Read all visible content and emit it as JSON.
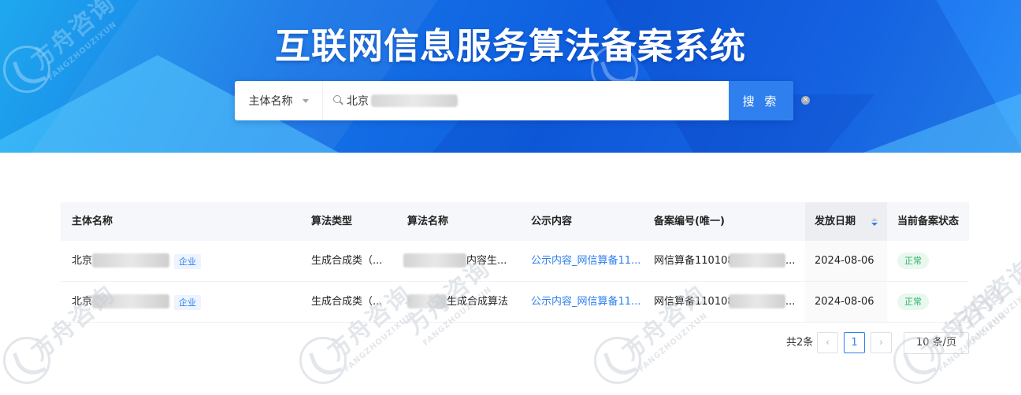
{
  "header": {
    "title": "互联网信息服务算法备案系统"
  },
  "search": {
    "scope_label": "主体名称",
    "query_value": "北京",
    "button_label": "搜 索"
  },
  "table": {
    "columns": [
      "主体名称",
      "算法类型",
      "算法名称",
      "公示内容",
      "备案编号(唯一)",
      "发放日期",
      "当前备案状态"
    ],
    "sorted_column": "发放日期",
    "rows": [
      {
        "entity": "北京",
        "entity_tag": "企业",
        "algo_type": "生成合成类（...",
        "algo_name": "内容生...",
        "public_content": "公示内容_网信算备11...",
        "record_no": "网信算备110108",
        "date": "2024-08-06",
        "status": "正常"
      },
      {
        "entity": "北京",
        "entity_tag": "企业",
        "algo_type": "生成合成类（...",
        "algo_name": "生成合成算法",
        "public_content": "公示内容_网信算备11...",
        "record_no": "网信算备110108",
        "date": "2024-08-06",
        "status": "正常"
      }
    ]
  },
  "pagination": {
    "total_label": "共2条",
    "prev_icon": "chevron-left-icon",
    "current_page": "1",
    "next_icon": "chevron-right-icon",
    "page_size_label": "10 条/页"
  },
  "watermark": {
    "brand": "方舟咨询",
    "brand_latin": "FANGZHOUZIXUN"
  },
  "colors": {
    "accent": "#2f80ee",
    "status_ok": "#2fb36a",
    "banner": "#1573e6"
  }
}
